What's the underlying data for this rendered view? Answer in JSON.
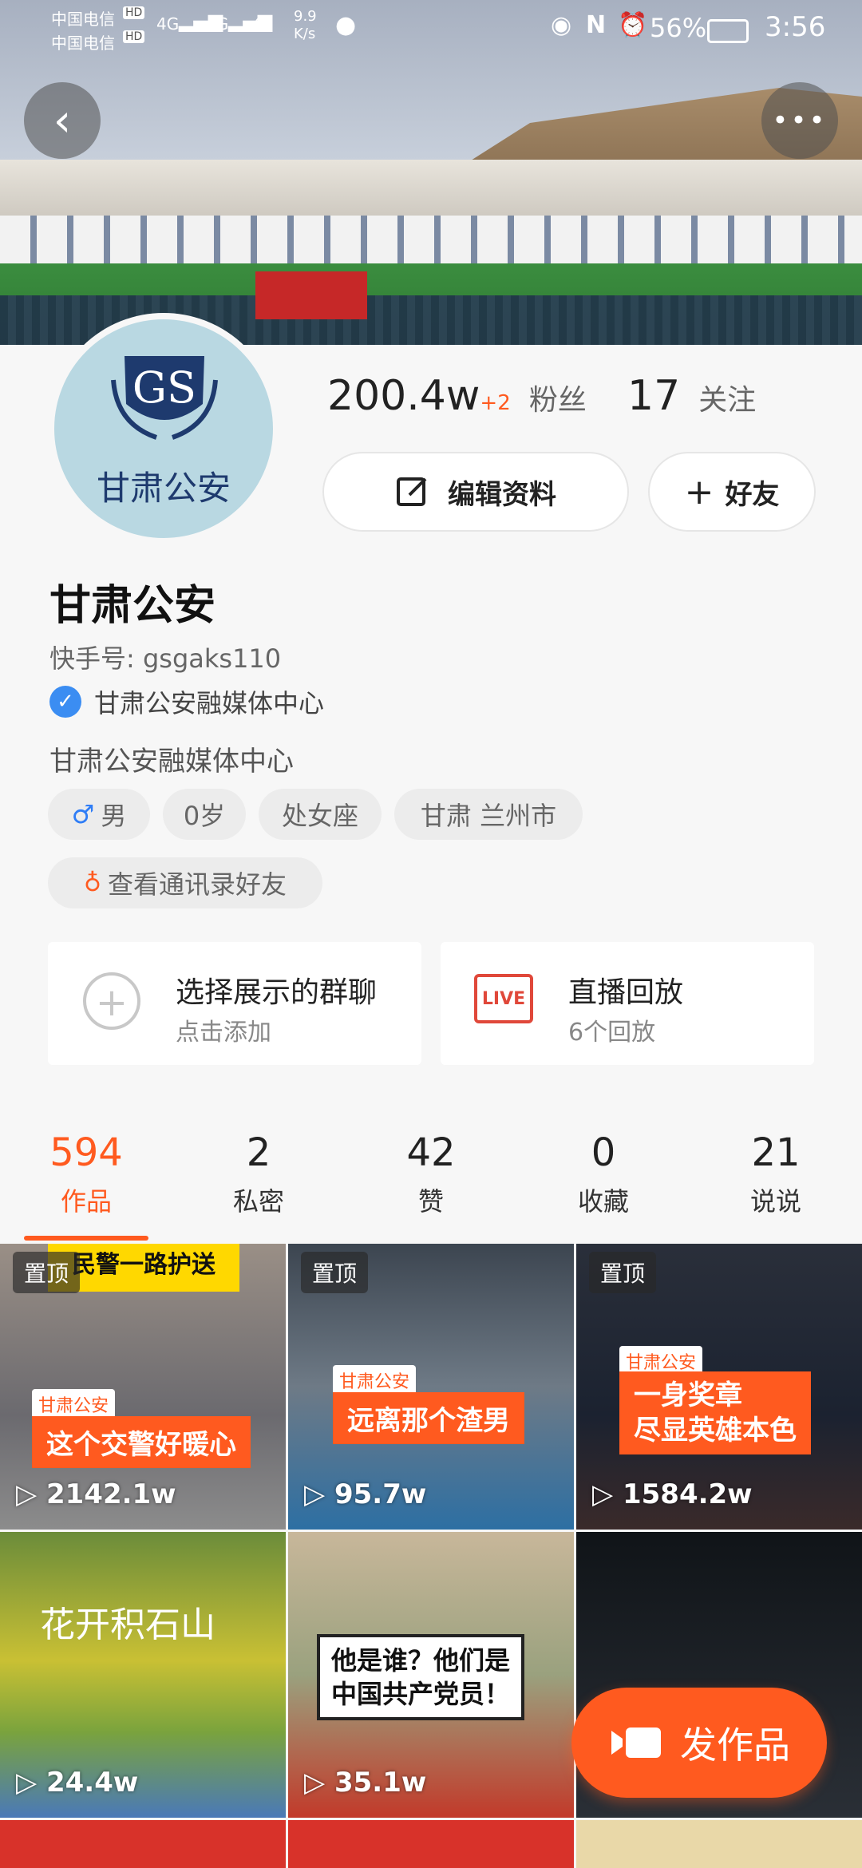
{
  "status_bar": {
    "carrier1": "中国电信",
    "carrier2": "中国电信",
    "hd1": "HD",
    "hd2": "HD",
    "signal1": "4G",
    "signal2": "4G",
    "speed_value": "9.9",
    "speed_unit": "K/s",
    "battery": "56%",
    "time": "3:56"
  },
  "profile": {
    "avatar_text": "甘肃公安",
    "fans_count": "200.4w",
    "fans_delta": "+2",
    "fans_label": "粉丝",
    "following_count": "17",
    "following_label": "关注",
    "edit_label": "编辑资料",
    "friend_label": "好友",
    "name": "甘肃公安",
    "kuaishou_id": "快手号: gsgaks110",
    "verified": "甘肃公安融媒体中心",
    "bio": "甘肃公安融媒体中心",
    "tags": [
      "男",
      "0岁",
      "处女座",
      "甘肃 兰州市"
    ],
    "contacts_label": "查看通讯录好友"
  },
  "cards": {
    "group": {
      "title": "选择展示的群聊",
      "subtitle": "点击添加"
    },
    "live": {
      "badge": "LIVE",
      "title": "直播回放",
      "subtitle": "6个回放"
    }
  },
  "tabs": [
    {
      "num": "594",
      "label": "作品"
    },
    {
      "num": "2",
      "label": "私密"
    },
    {
      "num": "42",
      "label": "赞"
    },
    {
      "num": "0",
      "label": "收藏"
    },
    {
      "num": "21",
      "label": "说说"
    }
  ],
  "videos": [
    {
      "pinned": "置顶",
      "views": "2142.1w",
      "tag": "甘肃公安",
      "caption": "这个交警好暖心",
      "top_text": "民警一路护送"
    },
    {
      "pinned": "置顶",
      "views": "95.7w",
      "tag": "甘肃公安",
      "caption": "远离那个渣男"
    },
    {
      "pinned": "置顶",
      "views": "1584.2w",
      "tag": "甘肃公安",
      "caption1": "一身奖章",
      "caption2": "尽显英雄本色"
    },
    {
      "views": "24.4w",
      "caption": "花开积石山"
    },
    {
      "views": "35.1w",
      "caption1": "他是谁？他们是",
      "caption2": "中国共产党员！"
    }
  ],
  "fab_label": "发作品"
}
